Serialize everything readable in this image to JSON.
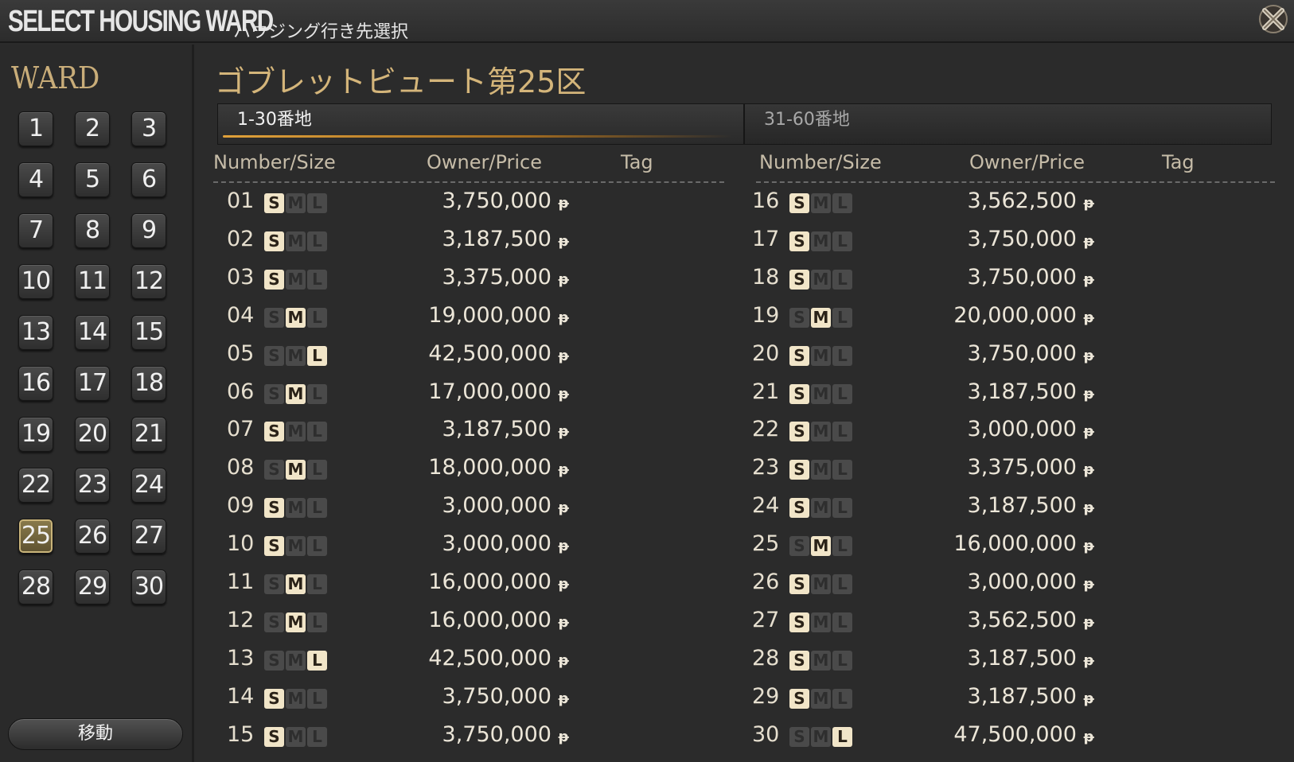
{
  "window": {
    "title": "SELECT HOUSING WARD",
    "subtitle": "ハウジング行き先選択"
  },
  "sidebar": {
    "ward_label": "WARD",
    "wards": [
      "1",
      "2",
      "3",
      "4",
      "5",
      "6",
      "7",
      "8",
      "9",
      "10",
      "11",
      "12",
      "13",
      "14",
      "15",
      "16",
      "17",
      "18",
      "19",
      "20",
      "21",
      "22",
      "23",
      "24",
      "25",
      "26",
      "27",
      "28",
      "29",
      "30"
    ],
    "selected_ward": "25",
    "move_button": "移動"
  },
  "main": {
    "ward_name": "ゴブレットビュート第25区",
    "tabs": [
      {
        "label": "1-30番地",
        "active": true
      },
      {
        "label": "31-60番地",
        "active": false
      }
    ],
    "headers": {
      "number_size": "Number/Size",
      "owner_price": "Owner/Price",
      "tag": "Tag"
    },
    "size_letters": [
      "S",
      "M",
      "L"
    ],
    "currency_symbol": "ᵽ",
    "plots_left": [
      {
        "number": "01",
        "size": "S",
        "price": "3,750,000"
      },
      {
        "number": "02",
        "size": "S",
        "price": "3,187,500"
      },
      {
        "number": "03",
        "size": "S",
        "price": "3,375,000"
      },
      {
        "number": "04",
        "size": "M",
        "price": "19,000,000"
      },
      {
        "number": "05",
        "size": "L",
        "price": "42,500,000"
      },
      {
        "number": "06",
        "size": "M",
        "price": "17,000,000"
      },
      {
        "number": "07",
        "size": "S",
        "price": "3,187,500"
      },
      {
        "number": "08",
        "size": "M",
        "price": "18,000,000"
      },
      {
        "number": "09",
        "size": "S",
        "price": "3,000,000"
      },
      {
        "number": "10",
        "size": "S",
        "price": "3,000,000"
      },
      {
        "number": "11",
        "size": "M",
        "price": "16,000,000"
      },
      {
        "number": "12",
        "size": "M",
        "price": "16,000,000"
      },
      {
        "number": "13",
        "size": "L",
        "price": "42,500,000"
      },
      {
        "number": "14",
        "size": "S",
        "price": "3,750,000"
      },
      {
        "number": "15",
        "size": "S",
        "price": "3,750,000"
      }
    ],
    "plots_right": [
      {
        "number": "16",
        "size": "S",
        "price": "3,562,500"
      },
      {
        "number": "17",
        "size": "S",
        "price": "3,750,000"
      },
      {
        "number": "18",
        "size": "S",
        "price": "3,750,000"
      },
      {
        "number": "19",
        "size": "M",
        "price": "20,000,000"
      },
      {
        "number": "20",
        "size": "S",
        "price": "3,750,000"
      },
      {
        "number": "21",
        "size": "S",
        "price": "3,187,500"
      },
      {
        "number": "22",
        "size": "S",
        "price": "3,000,000"
      },
      {
        "number": "23",
        "size": "S",
        "price": "3,375,000"
      },
      {
        "number": "24",
        "size": "S",
        "price": "3,187,500"
      },
      {
        "number": "25",
        "size": "M",
        "price": "16,000,000"
      },
      {
        "number": "26",
        "size": "S",
        "price": "3,000,000"
      },
      {
        "number": "27",
        "size": "S",
        "price": "3,562,500"
      },
      {
        "number": "28",
        "size": "S",
        "price": "3,187,500"
      },
      {
        "number": "29",
        "size": "S",
        "price": "3,187,500"
      },
      {
        "number": "30",
        "size": "L",
        "price": "47,500,000"
      }
    ]
  },
  "colors": {
    "accent_gold": "#d4b57a",
    "background": "#2b2b2b",
    "size_active": "#f1e5c8"
  },
  "icons": {
    "close": "close-x-icon"
  }
}
